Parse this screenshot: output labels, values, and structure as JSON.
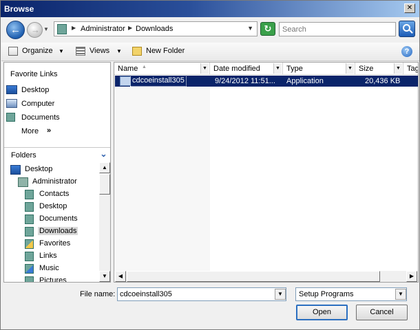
{
  "window": {
    "title": "Browse",
    "close_glyph": "✕"
  },
  "nav": {
    "back_icon": "back-arrow-icon",
    "forward_icon": "forward-arrow-icon",
    "breadcrumb": [
      "Administrator",
      "Downloads"
    ],
    "search_placeholder": "Search"
  },
  "toolbar": {
    "organize_label": "Organize",
    "views_label": "Views",
    "new_folder_label": "New Folder"
  },
  "favorites": {
    "header": "Favorite Links",
    "items": [
      {
        "label": "Desktop",
        "icon": "desktop-icon"
      },
      {
        "label": "Computer",
        "icon": "computer-icon"
      },
      {
        "label": "Documents",
        "icon": "documents-icon"
      }
    ],
    "more_label": "More",
    "more_glyph": "»"
  },
  "folders": {
    "header": "Folders",
    "tree": [
      {
        "label": "Desktop",
        "level": 0,
        "icon": "desktop-icon"
      },
      {
        "label": "Administrator",
        "level": 1,
        "icon": "user-folder-icon"
      },
      {
        "label": "Contacts",
        "level": 2,
        "icon": "contacts-folder-icon"
      },
      {
        "label": "Desktop",
        "level": 2,
        "icon": "folder-icon"
      },
      {
        "label": "Documents",
        "level": 2,
        "icon": "folder-icon"
      },
      {
        "label": "Downloads",
        "level": 2,
        "icon": "folder-icon",
        "selected": true
      },
      {
        "label": "Favorites",
        "level": 2,
        "icon": "favorites-folder-icon"
      },
      {
        "label": "Links",
        "level": 2,
        "icon": "folder-icon"
      },
      {
        "label": "Music",
        "level": 2,
        "icon": "music-folder-icon"
      },
      {
        "label": "Pictures",
        "level": 2,
        "icon": "folder-icon"
      }
    ]
  },
  "file_list": {
    "columns": [
      "Name",
      "Date modified",
      "Type",
      "Size",
      "Tag"
    ],
    "rows": [
      {
        "name": "cdcoeinstall305",
        "date_modified": "9/24/2012 11:51...",
        "type": "Application",
        "size": "20,436 KB",
        "selected": true
      }
    ]
  },
  "bottom": {
    "file_name_label": "File name:",
    "file_name_value": "cdcoeinstall305",
    "file_type_value": "Setup Programs",
    "open_label": "Open",
    "cancel_label": "Cancel"
  },
  "colors": {
    "selection": "#0a246a",
    "title_gradient_start": "#0a246a",
    "title_gradient_end": "#a6caf0"
  }
}
